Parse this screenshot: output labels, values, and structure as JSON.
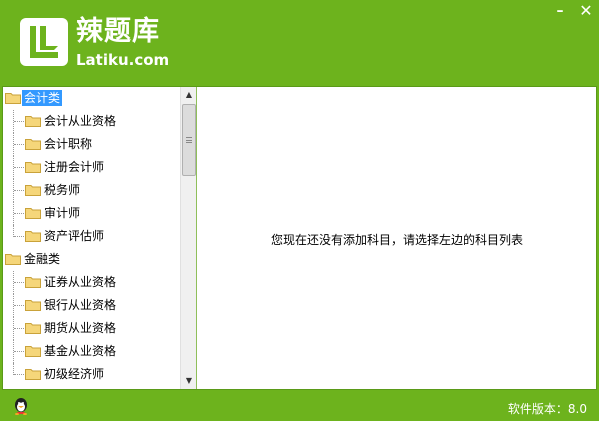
{
  "app": {
    "logo_title": "辣题库",
    "logo_sub": "Latiku.com",
    "minimize_glyph": "–",
    "close_glyph": "✕"
  },
  "tree": [
    {
      "label": "会计类",
      "level": 0,
      "selected": true
    },
    {
      "label": "会计从业资格",
      "level": 1
    },
    {
      "label": "会计职称",
      "level": 1
    },
    {
      "label": "注册会计师",
      "level": 1
    },
    {
      "label": "税务师",
      "level": 1
    },
    {
      "label": "审计师",
      "level": 1
    },
    {
      "label": "资产评估师",
      "level": 1
    },
    {
      "label": "金融类",
      "level": 0
    },
    {
      "label": "证券从业资格",
      "level": 1
    },
    {
      "label": "银行从业资格",
      "level": 1
    },
    {
      "label": "期货从业资格",
      "level": 1
    },
    {
      "label": "基金从业资格",
      "level": 1
    },
    {
      "label": "初级经济师",
      "level": 1
    }
  ],
  "main": {
    "empty_message": "您现在还没有添加科目，请选择左边的科目列表"
  },
  "footer": {
    "version_text": "软件版本：8.0"
  },
  "colors": {
    "brand_green": "#6db31d",
    "selection_blue": "#3399ff",
    "folder_yellow": "#f5d67a"
  }
}
